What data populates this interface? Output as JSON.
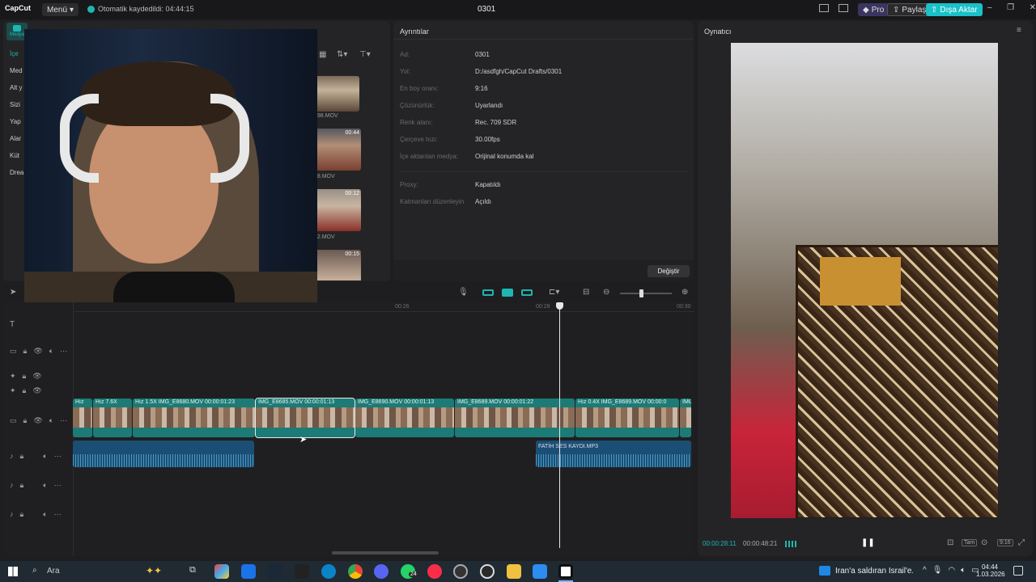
{
  "titlebar": {
    "logo": "CapCut",
    "menu": "Menü",
    "autosave": "Otomatik kaydedildi: 04:44:15",
    "project": "0301",
    "pro": "Pro",
    "share": "Paylaş",
    "export": "Dışa Aktar"
  },
  "media": {
    "side_tab": "Medya",
    "items": [
      "İçe",
      "Med",
      "Alt y",
      "Sizi",
      "Yap",
      "Alar",
      "Küt",
      "Drea"
    ],
    "thumbs": [
      {
        "dur": "",
        "name": "698.MOV"
      },
      {
        "dur": "00:44",
        "name": "48.MOV"
      },
      {
        "dur": "00:12",
        "name": "52.MOV"
      },
      {
        "dur": "00:15",
        "name": ""
      }
    ]
  },
  "details": {
    "title": "Ayrıntılar",
    "rows": [
      {
        "k": "Ad:",
        "v": "0301"
      },
      {
        "k": "Yol:",
        "v": "D:/asdfgh/CapCut Drafts/0301"
      },
      {
        "k": "En boy oranı:",
        "v": "9:16"
      },
      {
        "k": "Çözünürlük:",
        "v": "Uyarlandı"
      },
      {
        "k": "Renk alanı:",
        "v": "Rec. 709 SDR"
      },
      {
        "k": "Çerçeve hızı:",
        "v": "30.00fps"
      },
      {
        "k": "İçe aktarılan medya:",
        "v": "Orijinal konumda kal"
      }
    ],
    "rows2": [
      {
        "k": "Proxy:",
        "v": "Kapatıldı"
      },
      {
        "k": "Katmanları düzenleyin",
        "v": "Açıldı"
      }
    ],
    "change_btn": "Değiştir"
  },
  "player": {
    "title": "Oynatıcı",
    "current": "00:00:28:11",
    "total": "00:00:48:21",
    "ratio_btn": "9:16",
    "full_btn": "Tam"
  },
  "timeline": {
    "ruler": [
      "00:26",
      "00:28",
      "00:30"
    ],
    "clips": [
      {
        "label": "Hız"
      },
      {
        "label": "Hız 7.6X"
      },
      {
        "label": "Hız 1.5X  IMG_E8680.MOV  00:00:01:23"
      },
      {
        "label": "IMG_E8685.MOV  00:00:01:13"
      },
      {
        "label": "IMG_E8690.MOV  00:00:01:13"
      },
      {
        "label": "IMG_E8689.MOV  00:00:01:22"
      },
      {
        "label": "Hız 0.4X  IMG_E8689.MOV  00:00:0"
      },
      {
        "label": "IMG"
      }
    ],
    "audio_label": "FATİH SES KAYDI.MP3"
  },
  "taskbar": {
    "search": "Ara",
    "news": "İran'a saldıran İsrail'e...",
    "time": "04:44",
    "date": "1.03.2026",
    "badge": "24"
  },
  "colors": {
    "accent": "#1fb6b1",
    "export": "#19c1c8",
    "clip": "#1c7b76",
    "audio": "#1b4e74"
  }
}
